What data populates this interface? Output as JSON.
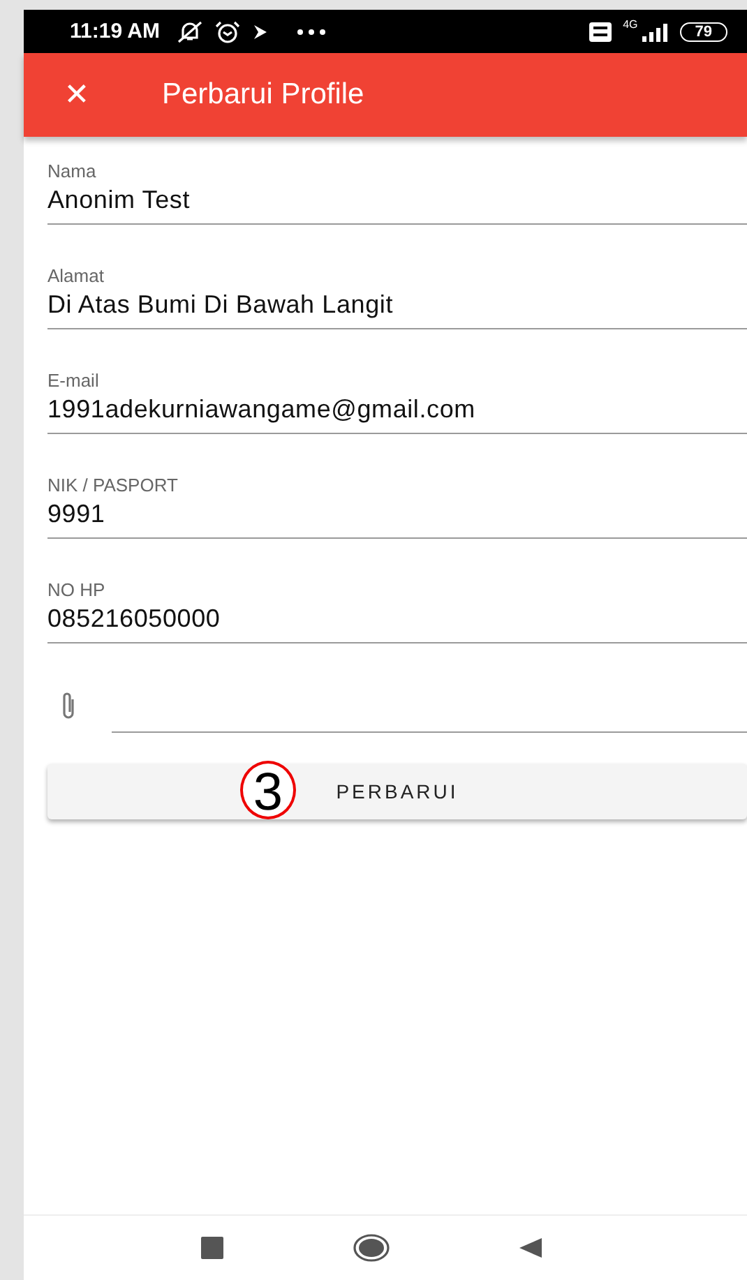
{
  "status_bar": {
    "time": "11:19 AM",
    "network": "4G",
    "battery": "79"
  },
  "app_bar": {
    "close_icon": "✕",
    "title": "Perbarui Profile"
  },
  "fields": [
    {
      "label": "Nama",
      "value": "Anonim Test"
    },
    {
      "label": "Alamat",
      "value": "Di Atas Bumi Di Bawah Langit"
    },
    {
      "label": "E-mail",
      "value": "1991adekurniawangame@gmail.com"
    },
    {
      "label": "NIK / PASPORT",
      "value": "9991"
    },
    {
      "label": "NO HP",
      "value": "085216050000"
    }
  ],
  "attachment": {
    "kind": "file"
  },
  "button": {
    "label": "PERBARUI",
    "annotation": "3"
  }
}
